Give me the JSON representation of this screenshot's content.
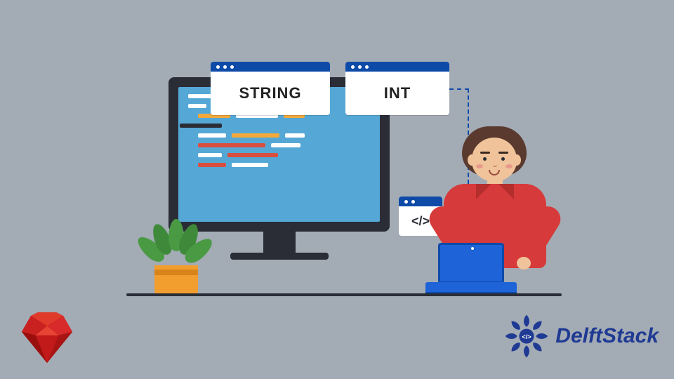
{
  "windows": {
    "string_label": "STRING",
    "int_label": "INT",
    "mini_code_label": "</>"
  },
  "brand": {
    "name": "DelftStack"
  },
  "icons": {
    "ruby": "ruby-gem-icon",
    "brand_mark": "delftstack-mandala-icon"
  },
  "colors": {
    "background": "#a3abb5",
    "accent_blue": "#0e4aa8",
    "shirt": "#d73a3a",
    "screen": "#55a8d6"
  }
}
